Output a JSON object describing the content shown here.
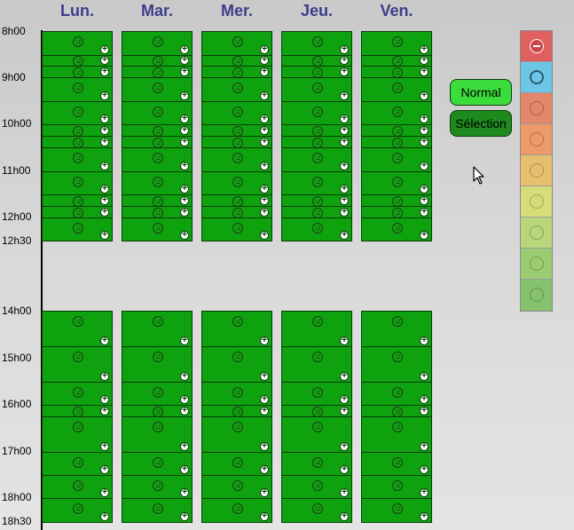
{
  "days": [
    "Lun.",
    "Mar.",
    "Mer.",
    "Jeu.",
    "Ven."
  ],
  "time_labels": [
    "8h00",
    "9h00",
    "10h00",
    "11h00",
    "12h00",
    "12h30",
    "14h00",
    "15h00",
    "16h00",
    "17h00",
    "18h00",
    "18h30"
  ],
  "buttons": {
    "normal_label": "Normal",
    "selection_label": "Sélection"
  },
  "colors": {
    "slot_green": "#0ea30e",
    "header_text": "#3d3d8a",
    "button_normal": "#3cdc3c",
    "button_selection": "#1e8a1e"
  },
  "palette": [
    {
      "name": "minus-icon",
      "color": "#e06060"
    },
    {
      "name": "headset-icon",
      "color": "#6ec6e6"
    },
    {
      "name": "very-sad-face-icon",
      "color": "#e4866a"
    },
    {
      "name": "sad-face-icon",
      "color": "#ec9a6a"
    },
    {
      "name": "neutral-face-icon",
      "color": "#e8bf6e"
    },
    {
      "name": "slight-smile-face-icon",
      "color": "#d6dc78"
    },
    {
      "name": "smile-face-icon",
      "color": "#b9d77a"
    },
    {
      "name": "happy-face-icon",
      "color": "#9ccc72"
    },
    {
      "name": "very-happy-face-icon",
      "color": "#86c26e"
    }
  ]
}
